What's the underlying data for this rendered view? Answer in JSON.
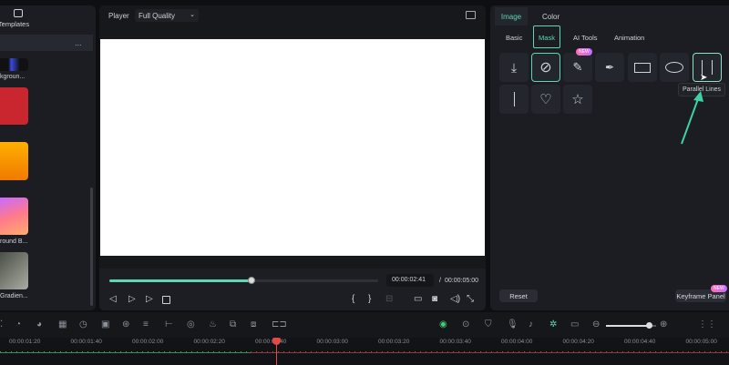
{
  "left_panel": {
    "tab_label": "Templates",
    "more_label": "...",
    "items": [
      {
        "label": "kgroun...",
        "color": "#2d3ad6"
      },
      {
        "label": "",
        "color": "#c9262f"
      },
      {
        "label": "",
        "color": "#f5a000"
      },
      {
        "label": "round B...",
        "color": "#ee6fa8"
      },
      {
        "label": "Gradien...",
        "color": "#7a7f74"
      }
    ]
  },
  "player": {
    "label": "Player",
    "quality": "Full Quality",
    "current_time": "00:00:02:41",
    "separator": "/",
    "total_time": "00:00:05:00",
    "progress": 0.53
  },
  "right_panel": {
    "tabs": [
      "Image",
      "Color"
    ],
    "active_tab": "Image",
    "subtabs": [
      "Basic",
      "Mask",
      "AI Tools",
      "Animation"
    ],
    "active_subtab": "Mask",
    "new_badge": "NEW",
    "masks": [
      "import-icon",
      "none-icon",
      "draw-icon",
      "pen-icon",
      "rectangle-icon",
      "ellipse-icon",
      "parallel-lines-icon",
      "single-line-icon",
      "heart-icon",
      "star-icon"
    ],
    "tooltip": "Parallel Lines",
    "reset_label": "Reset",
    "keyframe_label": "Keyframe Panel",
    "accent": "#5fd6b3"
  },
  "timeline": {
    "labels": [
      "00:00:01:20",
      "00:00:01:40",
      "00:00:02:00",
      "00:00:02:20",
      "00:00:02:40",
      "00:00:03:00",
      "00:00:03:20",
      "00:00:03:40",
      "00:00:04:00",
      "00:00:04:20",
      "00:00:04:40",
      "00:00:05:00"
    ],
    "zoom": 0.85
  }
}
